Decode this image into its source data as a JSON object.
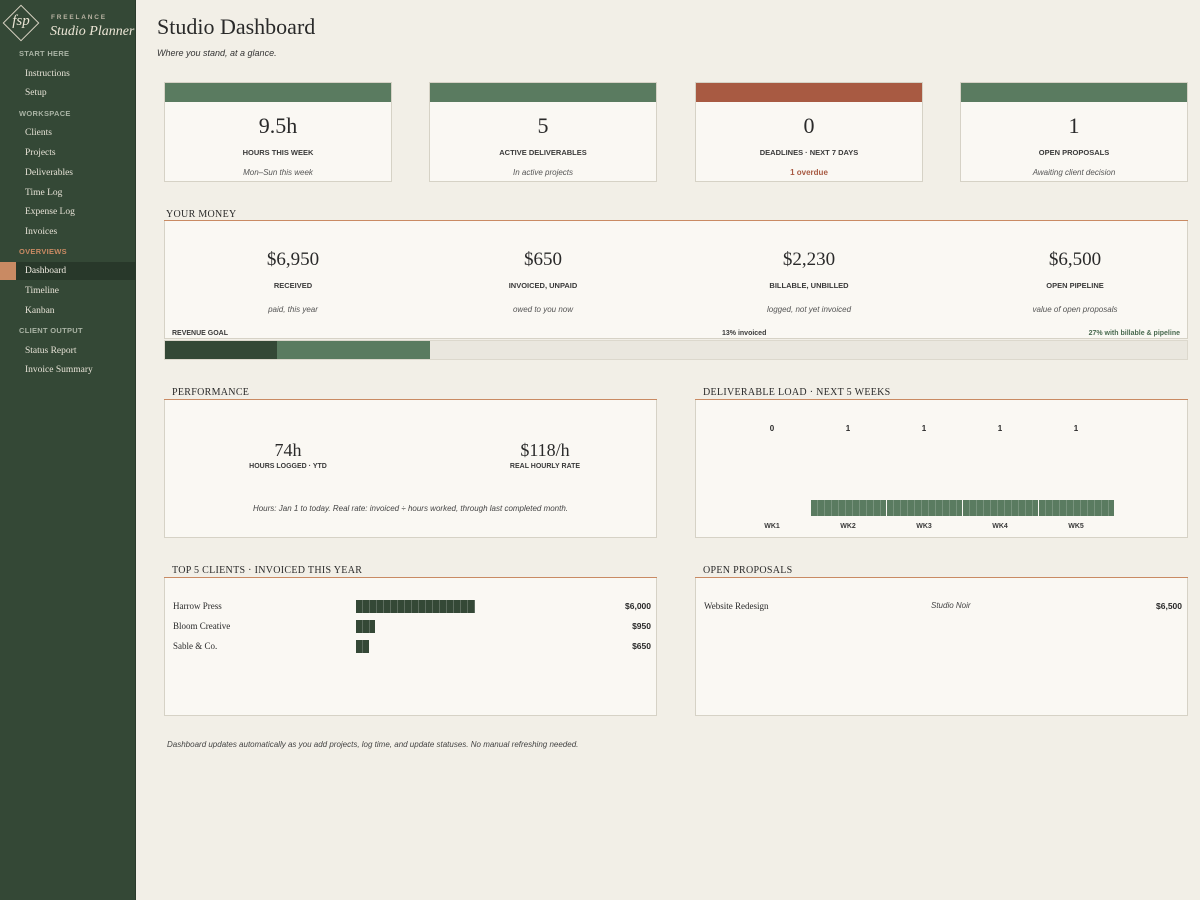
{
  "sidebar": {
    "logo": {
      "monogram": "fsp",
      "small": "FREELANCE",
      "big": "Studio Planner"
    },
    "sections": [
      {
        "label": "START HERE",
        "items": [
          "Instructions",
          "Setup"
        ]
      },
      {
        "label": "WORKSPACE",
        "items": [
          "Clients",
          "Projects",
          "Deliverables",
          "Time Log",
          "Expense Log",
          "Invoices"
        ]
      },
      {
        "label": "OVERVIEWS",
        "items": [
          "Dashboard",
          "Timeline",
          "Kanban"
        ]
      },
      {
        "label": "CLIENT OUTPUT",
        "items": [
          "Status Report",
          "Invoice Summary"
        ]
      }
    ],
    "active_item": "Dashboard"
  },
  "header": {
    "title": "Studio Dashboard",
    "subtitle": "Where you stand, at a glance."
  },
  "kpis": [
    {
      "value": "9.5h",
      "label": "HOURS THIS WEEK",
      "sub": "Mon–Sun this week",
      "color": "#5a7b60"
    },
    {
      "value": "5",
      "label": "ACTIVE DELIVERABLES",
      "sub": "In active projects",
      "color": "#5a7b60"
    },
    {
      "value": "0",
      "label": "DEADLINES  ·  NEXT 7 DAYS",
      "sub": "1 overdue",
      "color": "#a85a42"
    },
    {
      "value": "1",
      "label": "OPEN PROPOSALS",
      "sub": "Awaiting client decision",
      "color": "#5a7b60"
    }
  ],
  "money": {
    "heading": "YOUR MONEY",
    "cols": [
      {
        "value": "$6,950",
        "label": "RECEIVED",
        "sub": "paid, this year"
      },
      {
        "value": "$650",
        "label": "INVOICED, UNPAID",
        "sub": "owed to you now"
      },
      {
        "value": "$2,230",
        "label": "BILLABLE, UNBILLED",
        "sub": "logged, not yet invoiced"
      },
      {
        "value": "$6,500",
        "label": "OPEN PIPELINE",
        "sub": "value of open proposals"
      }
    ],
    "goal": {
      "label": "REVENUE GOAL",
      "invoiced_text": "13% invoiced",
      "pipeline_text": "27% with billable & pipeline",
      "invoiced_pct": 0.11,
      "pipeline_pct": 0.26
    }
  },
  "performance": {
    "heading": "PERFORMANCE",
    "hours_value": "74h",
    "hours_label": "HOURS LOGGED  ·  YTD",
    "rate_value": "$118/h",
    "rate_label": "REAL HOURLY RATE",
    "note": "Hours: Jan 1 to today.  Real rate: invoiced ÷ hours worked, through last completed month."
  },
  "deliverable_load": {
    "heading": "DELIVERABLE LOAD  ·  NEXT 5 WEEKS",
    "weeks": [
      {
        "label": "WK1",
        "count": 0
      },
      {
        "label": "WK2",
        "count": 1
      },
      {
        "label": "WK3",
        "count": 1
      },
      {
        "label": "WK4",
        "count": 1
      },
      {
        "label": "WK5",
        "count": 1
      }
    ]
  },
  "top_clients": {
    "heading": "TOP 5 CLIENTS  ·  INVOICED THIS YEAR",
    "rows": [
      {
        "name": "Harrow Press",
        "amount": "$6,000",
        "value": 6000
      },
      {
        "name": "Bloom Creative",
        "amount": "$950",
        "value": 950
      },
      {
        "name": "Sable & Co.",
        "amount": "$650",
        "value": 650
      }
    ]
  },
  "open_proposals": {
    "heading": "OPEN PROPOSALS",
    "rows": [
      {
        "name": "Website Redesign",
        "client": "Studio Noir",
        "amount": "$6,500"
      }
    ]
  },
  "footer_note": "Dashboard updates automatically as you add projects, log time, and update statuses. No manual refreshing needed."
}
